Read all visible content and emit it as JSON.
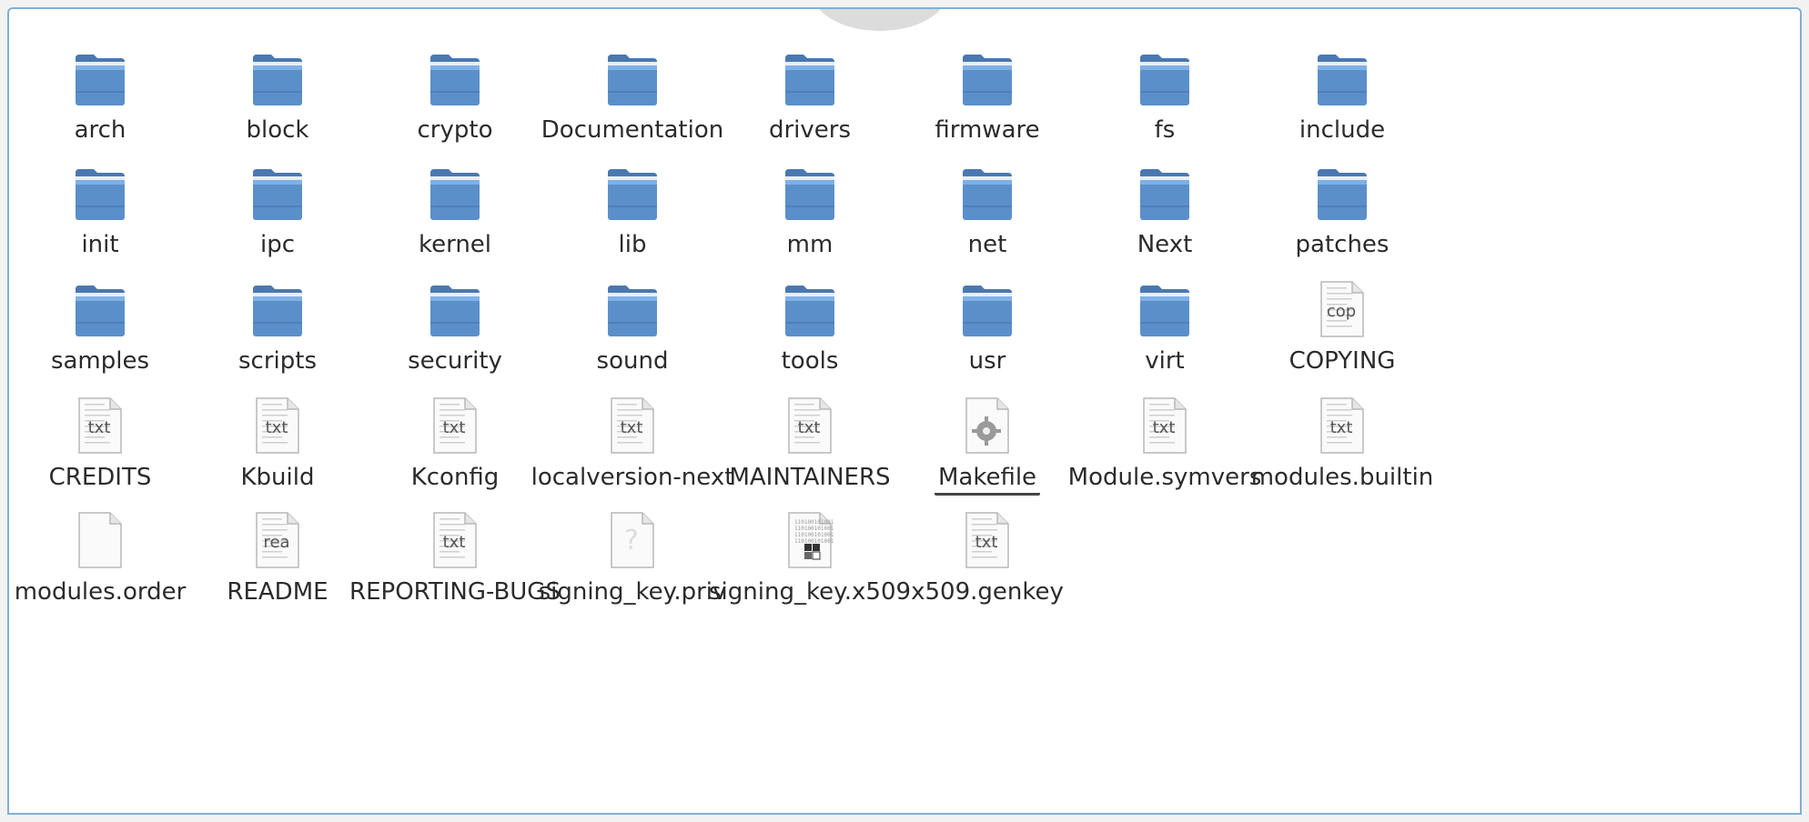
{
  "window": {
    "title": ""
  },
  "items": [
    {
      "name": "arch",
      "type": "folder"
    },
    {
      "name": "block",
      "type": "folder"
    },
    {
      "name": "crypto",
      "type": "folder"
    },
    {
      "name": "Documentation",
      "type": "folder"
    },
    {
      "name": "drivers",
      "type": "folder"
    },
    {
      "name": "firmware",
      "type": "folder"
    },
    {
      "name": "fs",
      "type": "folder"
    },
    {
      "name": "include",
      "type": "folder"
    },
    {
      "name": "init",
      "type": "folder"
    },
    {
      "name": "ipc",
      "type": "folder"
    },
    {
      "name": "kernel",
      "type": "folder"
    },
    {
      "name": "lib",
      "type": "folder"
    },
    {
      "name": "mm",
      "type": "folder"
    },
    {
      "name": "net",
      "type": "folder"
    },
    {
      "name": "Next",
      "type": "folder"
    },
    {
      "name": "patches",
      "type": "folder"
    },
    {
      "name": "samples",
      "type": "folder"
    },
    {
      "name": "scripts",
      "type": "folder"
    },
    {
      "name": "security",
      "type": "folder"
    },
    {
      "name": "sound",
      "type": "folder"
    },
    {
      "name": "tools",
      "type": "folder"
    },
    {
      "name": "usr",
      "type": "folder"
    },
    {
      "name": "virt",
      "type": "folder"
    },
    {
      "name": "COPYING",
      "type": "text",
      "tag": "cop"
    },
    {
      "name": "CREDITS",
      "type": "text",
      "tag": "txt"
    },
    {
      "name": "Kbuild",
      "type": "text",
      "tag": "txt"
    },
    {
      "name": "Kconfig",
      "type": "text",
      "tag": "txt"
    },
    {
      "name": "localversion-next",
      "type": "text",
      "tag": "txt"
    },
    {
      "name": "MAINTAINERS",
      "type": "text",
      "tag": "txt"
    },
    {
      "name": "Makefile",
      "type": "makefile",
      "hovered": true
    },
    {
      "name": "Module.symvers",
      "type": "text",
      "tag": "txt"
    },
    {
      "name": "modules.builtin",
      "type": "text",
      "tag": "txt"
    },
    {
      "name": "modules.order",
      "type": "blank"
    },
    {
      "name": "README",
      "type": "text",
      "tag": "rea"
    },
    {
      "name": "REPORTING-BUGS",
      "type": "text",
      "tag": "txt"
    },
    {
      "name": "signing_key.priv",
      "type": "unknown"
    },
    {
      "name": "signing_key.x509",
      "type": "binary"
    },
    {
      "name": "x509.genkey",
      "type": "text",
      "tag": "txt"
    }
  ],
  "colors": {
    "folder_body": "#5b8fc9",
    "folder_tab": "#4a78b0",
    "folder_top": "#7fb0e6",
    "window_border": "#7fb0d8",
    "label_text": "#2b2b2b"
  }
}
